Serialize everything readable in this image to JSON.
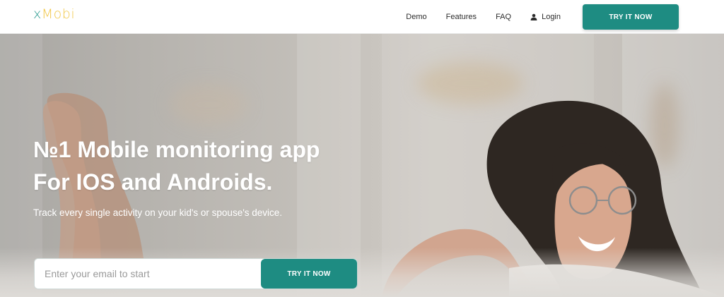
{
  "header": {
    "logo_prefix": "x",
    "logo_suffix": "Mobi",
    "nav": {
      "demo": "Demo",
      "features": "Features",
      "faq": "FAQ",
      "login": "Login"
    },
    "cta_label": "TRY IT NOW"
  },
  "hero": {
    "title_line1": "№1 Mobile monitoring app",
    "title_line2": "For IOS and Androids.",
    "subtitle": "Track every single activity on your kid's or spouse's device.",
    "email_placeholder": "Enter your email to start",
    "cta_label": "TRY IT NOW"
  },
  "colors": {
    "accent": "#1e8c82",
    "logo_x": "#2a9a8f",
    "logo_mobi": "#f1c84a"
  }
}
